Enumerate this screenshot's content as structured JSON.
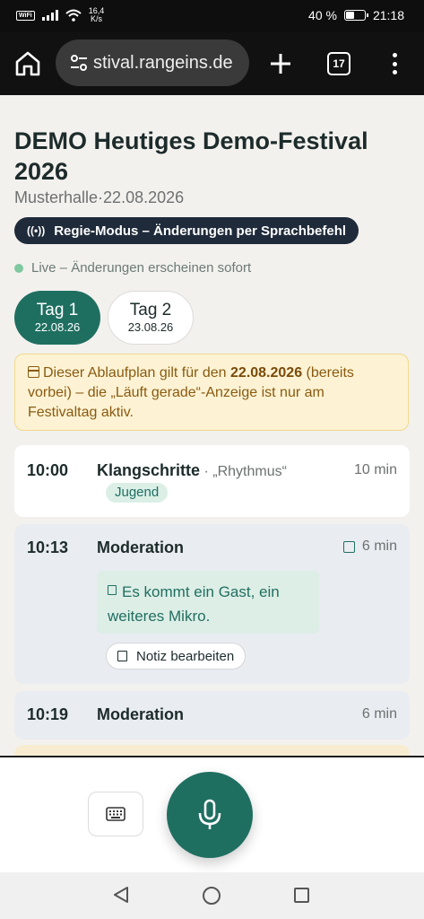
{
  "status_bar": {
    "wifi_label": "WiFi",
    "speed_value": "16,4",
    "speed_unit": "K/s",
    "battery_percent": "40 %",
    "battery_level": 0.4,
    "time": "21:18"
  },
  "browser": {
    "url": "stival.rangeins.de",
    "tab_count": "17",
    "icons": [
      "home-icon",
      "tune-icon",
      "plus-icon",
      "tabs-icon",
      "more-vert-icon"
    ]
  },
  "event": {
    "title": "DEMO Heutiges Demo-Festival 2026",
    "venue": "Musterhalle",
    "separator": "·",
    "date": "22.08.2026"
  },
  "regie_badge": {
    "icon": "((•))",
    "label": "Regie-Modus – Änderungen per Sprachbefehl"
  },
  "live_status": "Live – Änderungen erscheinen sofort",
  "day_tabs": [
    {
      "label": "Tag 1",
      "date": "22.08.26",
      "active": true
    },
    {
      "label": "Tag 2",
      "date": "23.08.26",
      "active": false
    }
  ],
  "notice": {
    "prefix": "Dieser Ablaufplan gilt für den ",
    "date": "22.08.2026",
    "suffix": " (bereits vorbei) – die „Läuft gerade“-Anzeige ist nur am Festivaltag aktiv."
  },
  "schedule": [
    {
      "time": "10:00",
      "title": "Klangschritte",
      "meta": " · „Rhythmus“",
      "duration": "10 min",
      "tag": "Jugend"
    },
    {
      "time": "10:13",
      "title": "Moderation",
      "duration": "6 min",
      "note": "Es kommt ein Gast, ein weiteres Mikro.",
      "edit_label": "Notiz bearbeiten"
    },
    {
      "time": "10:19",
      "title": "Moderation",
      "duration": "6 min"
    }
  ],
  "controls": {
    "keyboard_icon": "keyboard-icon",
    "mic_icon": "microphone-icon"
  },
  "colors": {
    "accent": "#1f6f61",
    "badge_dark": "#1f2b3a",
    "notice_bg": "#fdf3d4",
    "live_dot": "#7fc8a0"
  }
}
